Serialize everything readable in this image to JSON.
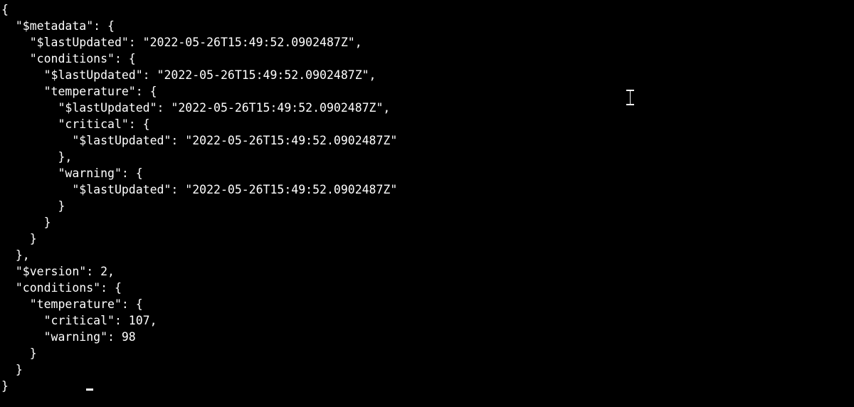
{
  "code": {
    "line1": "{",
    "line2": "  \"$metadata\": {",
    "line3": "    \"$lastUpdated\": \"2022-05-26T15:49:52.0902487Z\",",
    "line4": "    \"conditions\": {",
    "line5": "      \"$lastUpdated\": \"2022-05-26T15:49:52.0902487Z\",",
    "line6": "      \"temperature\": {",
    "line7": "        \"$lastUpdated\": \"2022-05-26T15:49:52.0902487Z\",",
    "line8": "        \"critical\": {",
    "line9": "          \"$lastUpdated\": \"2022-05-26T15:49:52.0902487Z\"",
    "line10": "        },",
    "line11": "        \"warning\": {",
    "line12": "          \"$lastUpdated\": \"2022-05-26T15:49:52.0902487Z\"",
    "line13": "        }",
    "line14": "      }",
    "line15": "    }",
    "line16": "  },",
    "line17": "  \"$version\": 2,",
    "line18": "  \"conditions\": {",
    "line19": "    \"temperature\": {",
    "line20": "      \"critical\": 107,",
    "line21": "      \"warning\": 98",
    "line22": "    }",
    "line23": "  }",
    "line24": "}"
  }
}
